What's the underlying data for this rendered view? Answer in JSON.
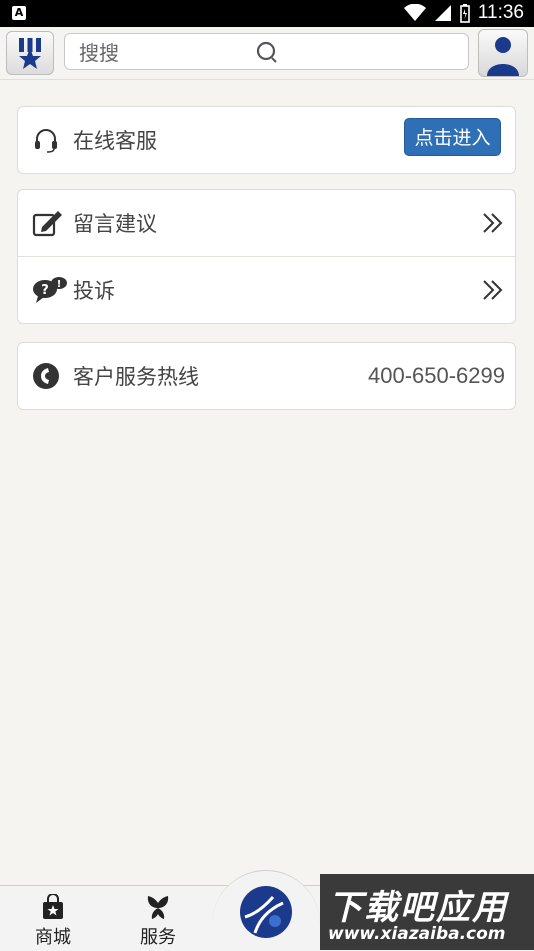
{
  "status_bar": {
    "time": "11:36",
    "notification_glyph": "A"
  },
  "header": {
    "search_placeholder": "搜搜"
  },
  "cards": {
    "online_service": {
      "label": "在线客服",
      "button_label": "点击进入"
    },
    "suggestion": {
      "label": "留言建议"
    },
    "complaint": {
      "label": "投诉"
    },
    "hotline": {
      "label": "客户服务热线",
      "phone": "400-650-6299"
    }
  },
  "tabbar": {
    "items": [
      {
        "label": "商城",
        "icon": "shopping-bag-icon"
      },
      {
        "label": "服务",
        "icon": "flower-icon"
      }
    ]
  },
  "watermark": {
    "title": "下载吧应用",
    "url": "www.xiazaiba.com"
  },
  "colors": {
    "accent": "#2e6fb5",
    "brand_navy": "#1b3a8c",
    "background": "#f5f4f0"
  }
}
